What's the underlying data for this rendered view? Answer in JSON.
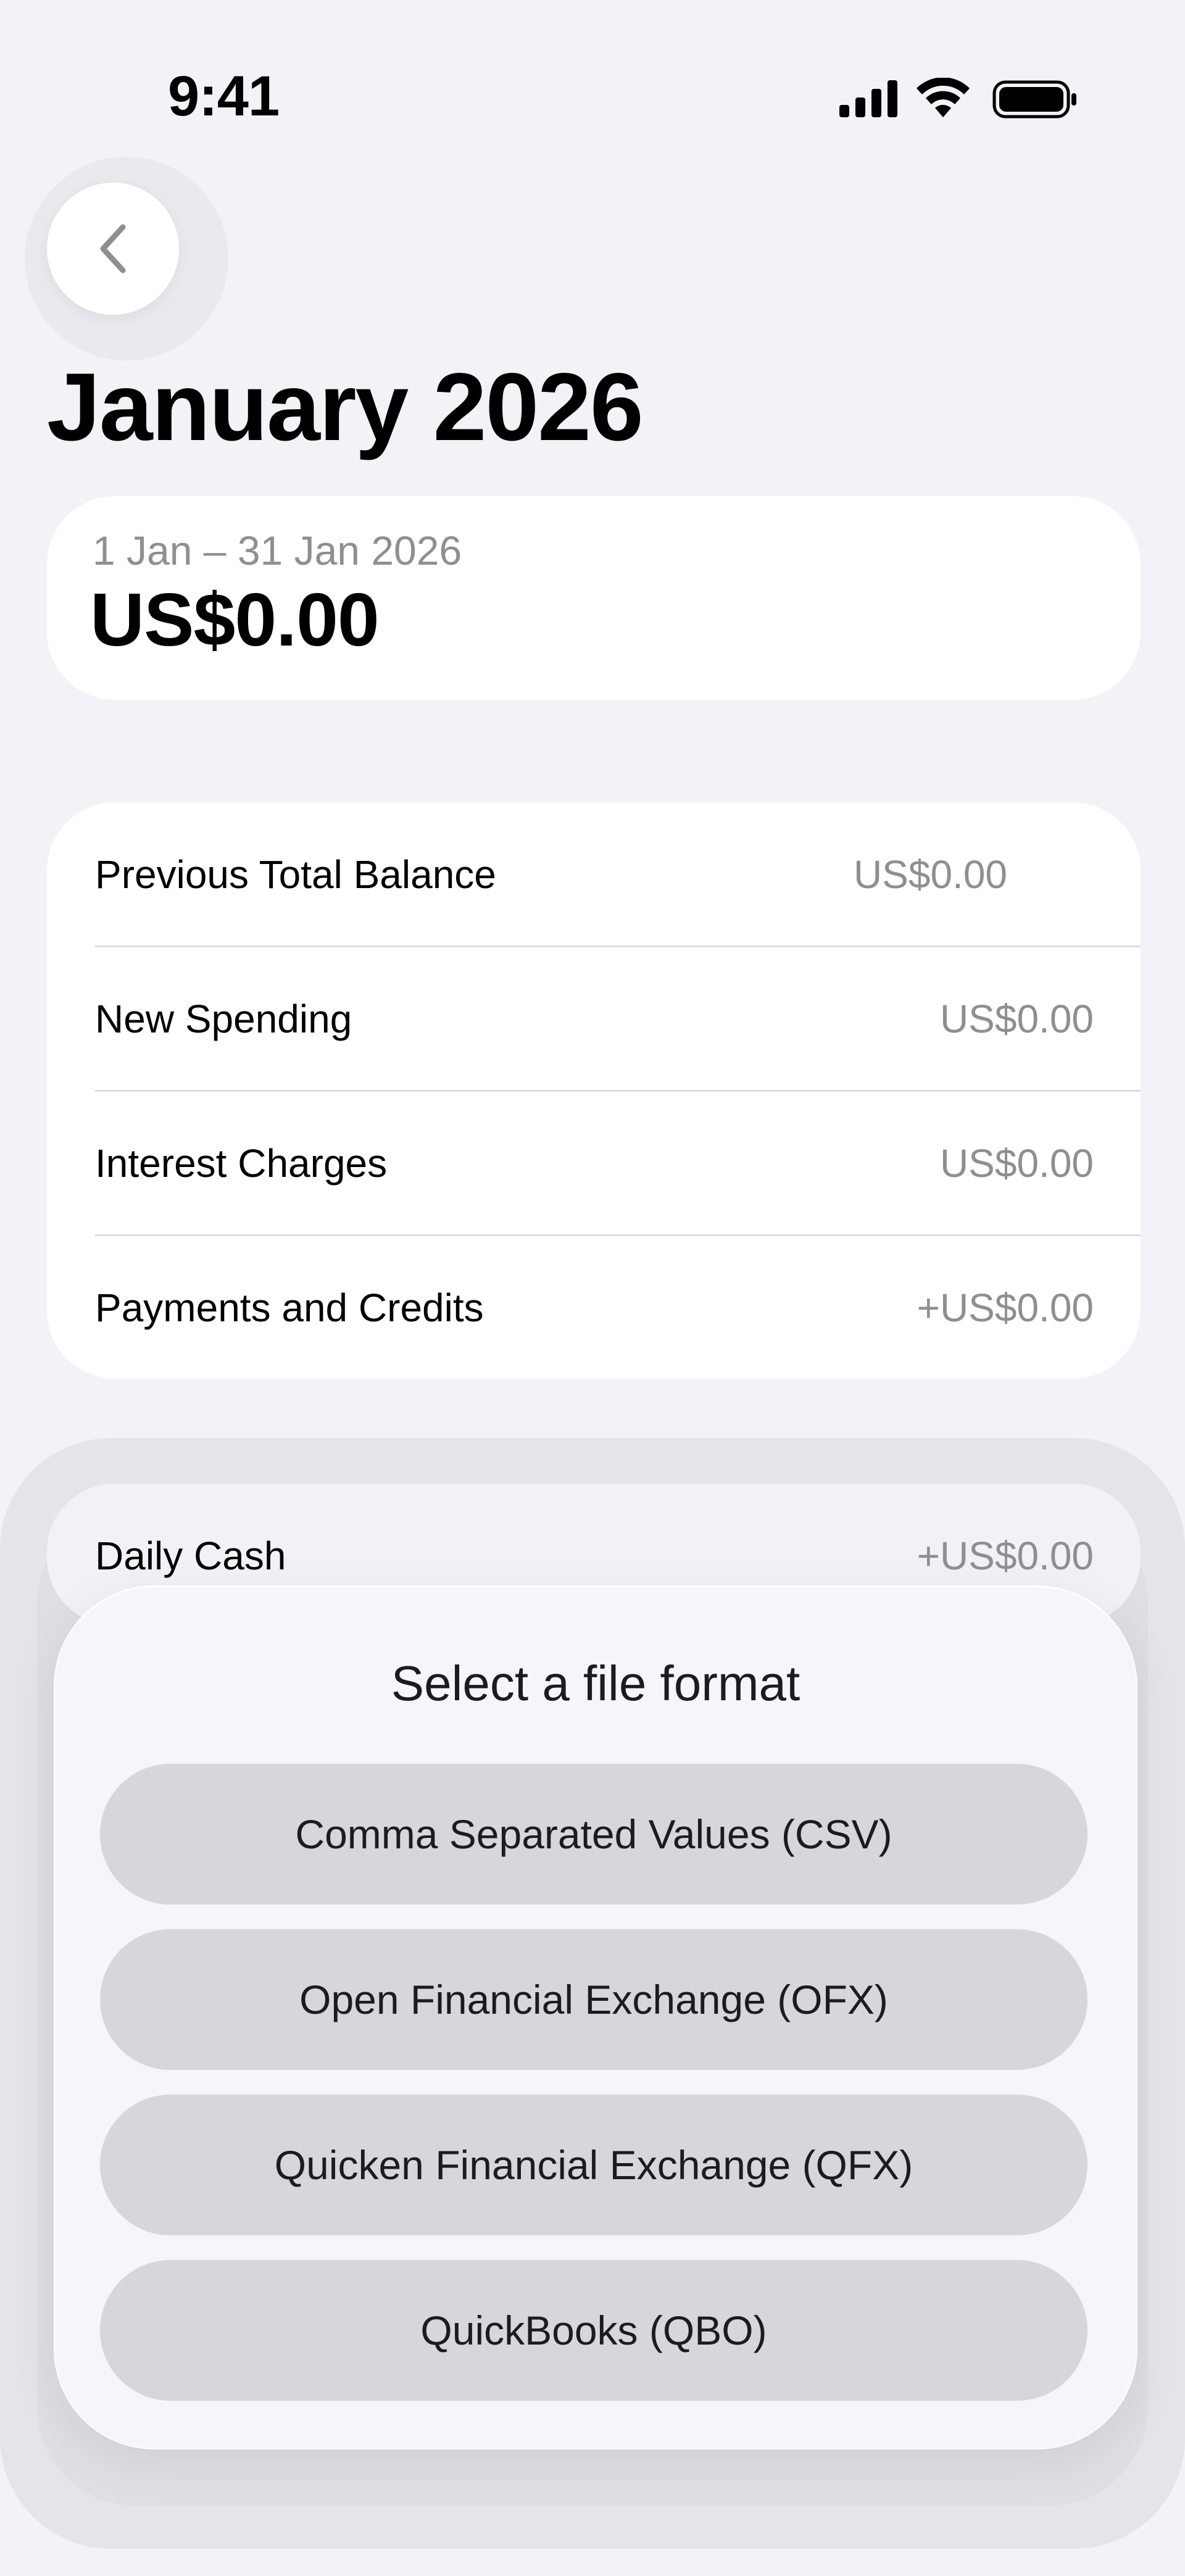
{
  "status_bar": {
    "time": "9:41",
    "icons": [
      "cellular-signal-icon",
      "wifi-icon",
      "battery-icon"
    ]
  },
  "nav": {
    "back_icon": "chevron-left-icon"
  },
  "page": {
    "title": "January 2026"
  },
  "summary": {
    "date_range": "1 Jan – 31 Jan 2026",
    "amount": "US$0.00"
  },
  "details": [
    {
      "label": "Previous Total Balance",
      "value": "US$0.00"
    },
    {
      "label": "New Spending",
      "value": "US$0.00"
    },
    {
      "label": "Interest Charges",
      "value": "US$0.00"
    },
    {
      "label": "Payments and Credits",
      "value": "+US$0.00"
    }
  ],
  "daily_cash": {
    "label": "Daily Cash",
    "value": "+US$0.00"
  },
  "sheet": {
    "title": "Select a file format",
    "options": [
      "Comma Separated Values (CSV)",
      "Open Financial Exchange (OFX)",
      "Quicken Financial Exchange (QFX)",
      "QuickBooks (QBO)"
    ]
  },
  "colors": {
    "background": "#f2f2f7",
    "card": "#ffffff",
    "secondary_text": "#8e8e93",
    "button_fill": "#d6d6db"
  }
}
